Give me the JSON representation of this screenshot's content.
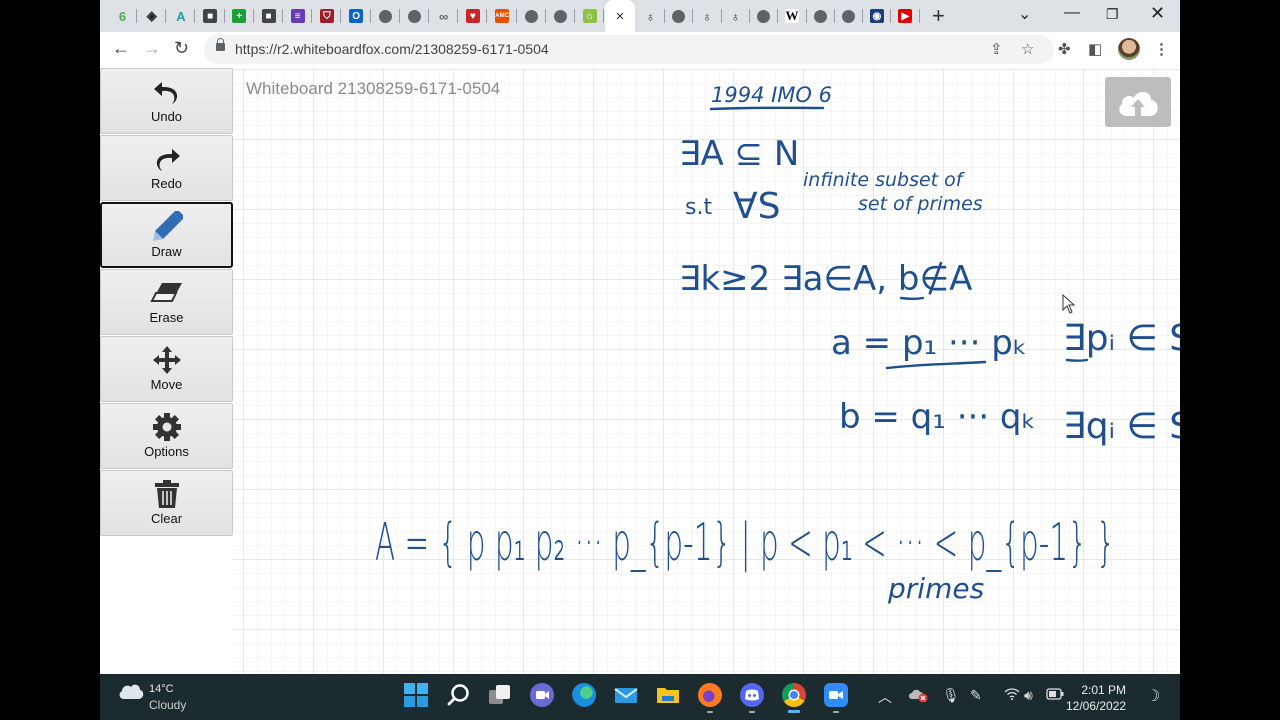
{
  "browser": {
    "tabs": [
      {
        "icon": "leaf-icon",
        "color": "#4caf50",
        "glyph": "6"
      },
      {
        "icon": "diamond-logo-icon",
        "color": "#222222",
        "glyph": "◈"
      },
      {
        "icon": "a-logo-icon",
        "color": "#1aa3a3",
        "glyph": "A"
      },
      {
        "icon": "cube-icon",
        "color": "#444444",
        "glyph": "■"
      },
      {
        "icon": "plus-square-icon",
        "color": "#1e9e3a",
        "glyph": "+"
      },
      {
        "icon": "cube-icon",
        "color": "#444444",
        "glyph": "■"
      },
      {
        "icon": "list-icon",
        "color": "#673ab7",
        "glyph": "≡"
      },
      {
        "icon": "shield-crest-icon",
        "color": "#a01c2c",
        "glyph": "⛉"
      },
      {
        "icon": "outlook-icon",
        "color": "#0a64c8",
        "glyph": "O"
      },
      {
        "icon": "globe-icon",
        "color": "#5f6368",
        "glyph": ""
      },
      {
        "icon": "globe-icon",
        "color": "#5f6368",
        "glyph": ""
      },
      {
        "icon": "link-icon",
        "color": "#666666",
        "glyph": "∞"
      },
      {
        "icon": "heart-icon",
        "color": "#c62828",
        "glyph": "♥"
      },
      {
        "icon": "amc-icon",
        "color": "#e65100",
        "glyph": "AMC"
      },
      {
        "icon": "globe-icon",
        "color": "#5f6368",
        "glyph": ""
      },
      {
        "icon": "globe-icon",
        "color": "#5f6368",
        "glyph": ""
      },
      {
        "icon": "whiteboardfox-icon",
        "color": "#8bc34a",
        "glyph": "⌂"
      }
    ],
    "tabs_right": [
      {
        "icon": "acorn-icon",
        "color": "#333333",
        "glyph": "♁"
      },
      {
        "icon": "globe-icon",
        "color": "#5f6368",
        "glyph": ""
      },
      {
        "icon": "acorn-icon",
        "color": "#333333",
        "glyph": "♁"
      },
      {
        "icon": "acorn-icon",
        "color": "#333333",
        "glyph": "♁"
      },
      {
        "icon": "globe-icon",
        "color": "#5f6368",
        "glyph": ""
      },
      {
        "icon": "wikipedia-icon",
        "color": "#000000",
        "glyph": "W"
      },
      {
        "icon": "globe-icon",
        "color": "#5f6368",
        "glyph": ""
      },
      {
        "icon": "globe-icon",
        "color": "#5f6368",
        "glyph": ""
      },
      {
        "icon": "target-icon",
        "color": "#1a3d7c",
        "glyph": "◉"
      },
      {
        "icon": "youtube-icon",
        "color": "#e00000",
        "glyph": "▶"
      }
    ],
    "active_tab_close": "×",
    "new_tab": "+",
    "url": "https://r2.whiteboardfox.com/21308259-6171-0504"
  },
  "whiteboard": {
    "title": "Whiteboard 21308259-6171-0504",
    "ink_color": "#1f4f8f",
    "tools": [
      {
        "id": "undo",
        "label": "Undo",
        "active": false
      },
      {
        "id": "redo",
        "label": "Redo",
        "active": false
      },
      {
        "id": "draw",
        "label": "Draw",
        "active": true
      },
      {
        "id": "erase",
        "label": "Erase",
        "active": false
      },
      {
        "id": "move",
        "label": "Move",
        "active": false
      },
      {
        "id": "options",
        "label": "Options",
        "active": false
      },
      {
        "id": "clear",
        "label": "Clear",
        "active": false
      }
    ],
    "handwriting": {
      "heading": "1994 IMO 6",
      "line1": "∃A ⊆ N",
      "line2_prefix": "s.t",
      "line2": "∀S",
      "note1": "infinite subset of",
      "note2": "set of primes",
      "line3": "∃k≥2 ∃a∈A, b∉A",
      "line4": "a = p₁ ··· pₖ",
      "line4_right": "∃pᵢ ∈ S",
      "line5": "b = q₁ ··· qₖ",
      "line5_right": "∃qᵢ ∈ S.",
      "set_def": "A = { p p₁ p₂ ··· p_{p-1} | p < p₁ < ··· < p_{p-1} }",
      "set_note": "primes"
    }
  },
  "taskbar": {
    "weather_temp": "14°C",
    "weather_cond": "Cloudy",
    "time": "2:01 PM",
    "date": "12/06/2022"
  }
}
